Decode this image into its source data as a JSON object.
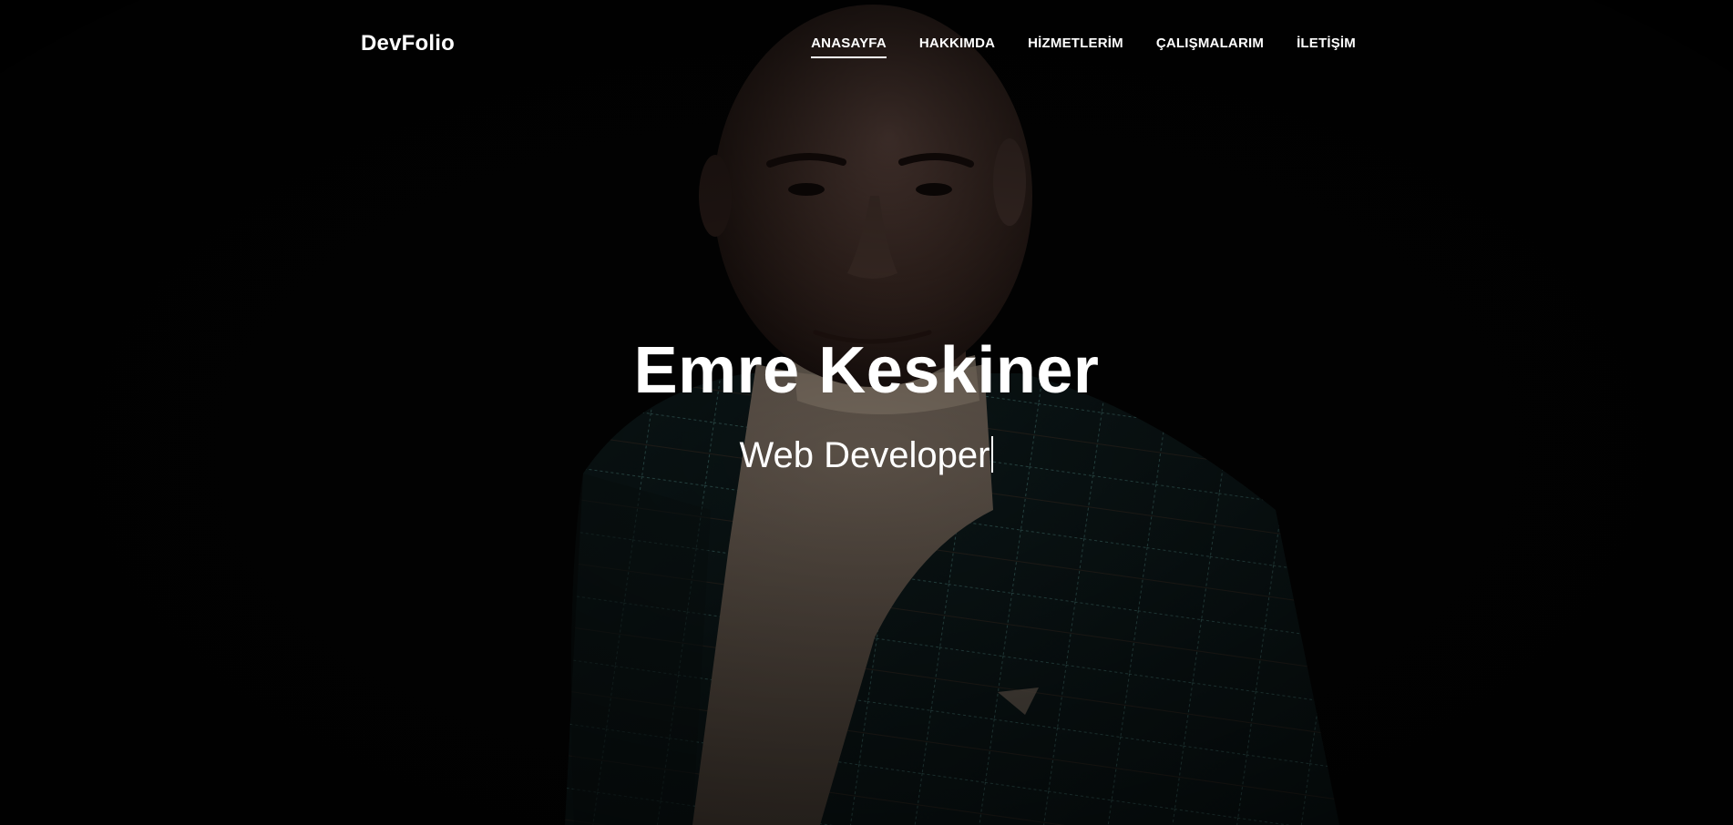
{
  "brand": {
    "name": "DevFolio"
  },
  "nav": {
    "items": [
      {
        "label": "ANASAYFA",
        "active": true
      },
      {
        "label": "HAKKIMDA",
        "active": false
      },
      {
        "label": "HİZMETLERİM",
        "active": false
      },
      {
        "label": "ÇALIŞMALARIM",
        "active": false
      },
      {
        "label": "İLETİŞİM",
        "active": false
      }
    ]
  },
  "hero": {
    "title": "Emre Keskiner",
    "subtitle": "Web Developer",
    "background_image": "portrait-photo"
  },
  "colors": {
    "background": "#020202",
    "text": "#ffffff",
    "jacket": "#0f2324",
    "sweater": "#7a6c5e"
  }
}
